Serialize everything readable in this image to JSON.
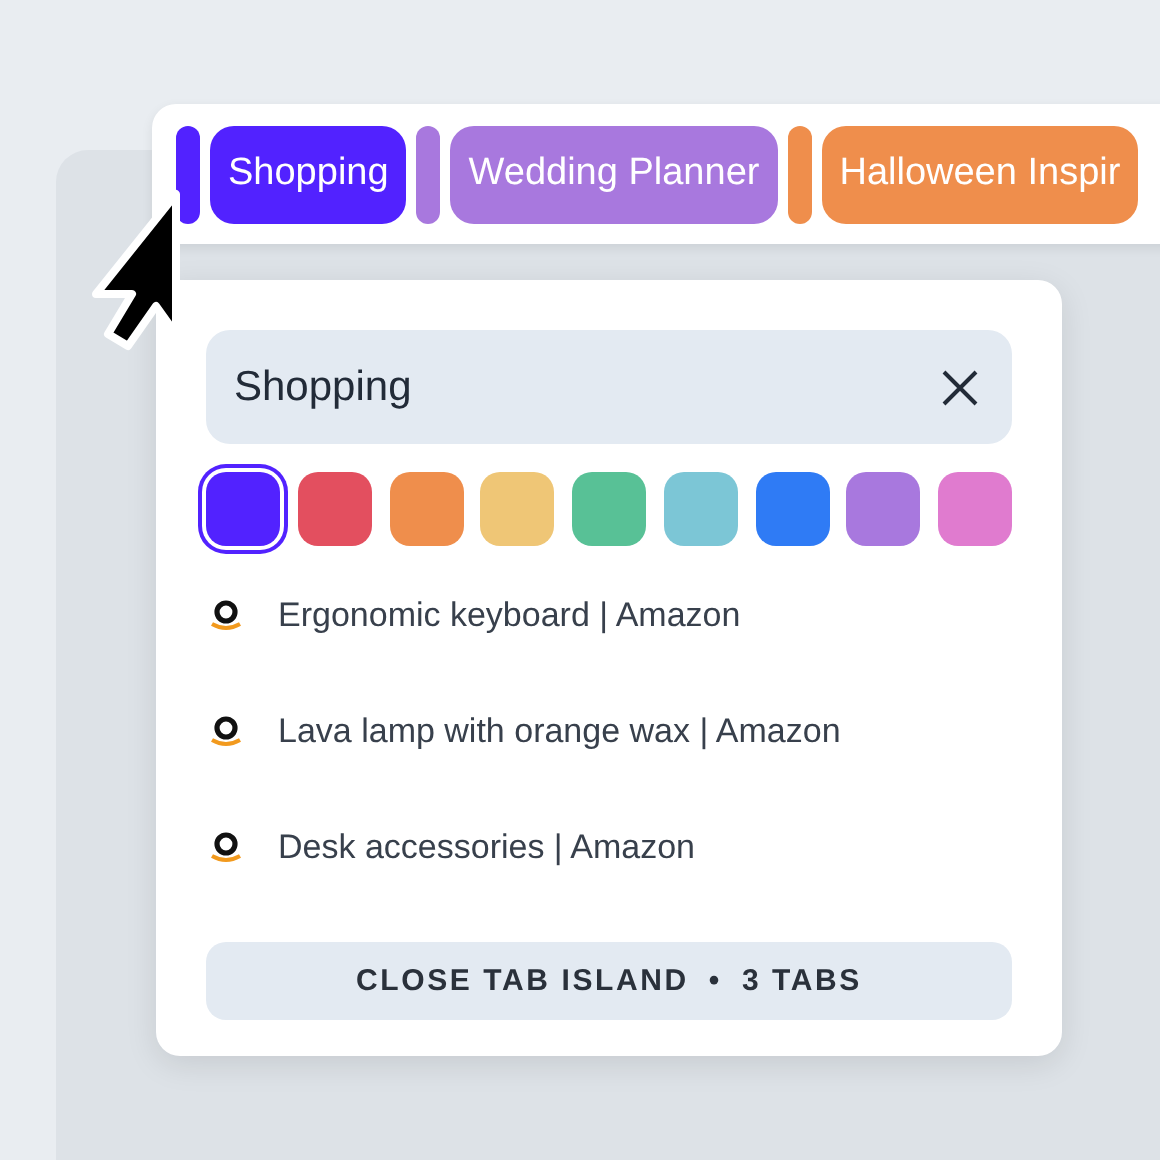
{
  "tab_groups": [
    {
      "label": "Shopping",
      "color": "#5222ff"
    },
    {
      "label": "Wedding Planner",
      "color": "#a878de"
    },
    {
      "label": "Halloween Inspir",
      "color": "#ef8e4c"
    }
  ],
  "editor": {
    "name_field": {
      "value": "Shopping"
    },
    "swatches": [
      {
        "color": "#5222ff",
        "selected": true
      },
      {
        "color": "#e34f5f",
        "selected": false
      },
      {
        "color": "#ef8e4c",
        "selected": false
      },
      {
        "color": "#efc676",
        "selected": false
      },
      {
        "color": "#58c196",
        "selected": false
      },
      {
        "color": "#7cc6d6",
        "selected": false
      },
      {
        "color": "#2f7bf5",
        "selected": false
      },
      {
        "color": "#a878de",
        "selected": false
      },
      {
        "color": "#e07bcf",
        "selected": false
      }
    ],
    "tabs": [
      {
        "title": "Ergonomic keyboard | Amazon"
      },
      {
        "title": "Lava lamp with orange wax | Amazon"
      },
      {
        "title": "Desk accessories | Amazon"
      }
    ],
    "close_button": {
      "label": "CLOSE TAB ISLAND",
      "separator": "•",
      "count": "3 TABS"
    }
  }
}
